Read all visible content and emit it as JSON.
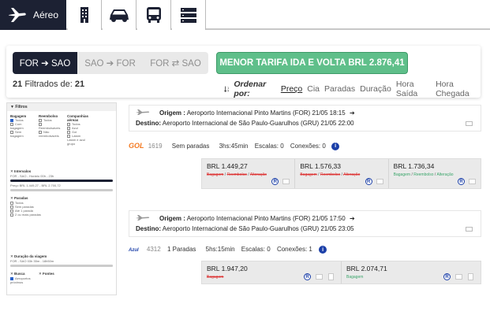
{
  "nav": {
    "active_label": "Aéreo",
    "tabs": [
      {
        "name": "hotel-icon"
      },
      {
        "name": "car-icon"
      },
      {
        "name": "bus-icon"
      },
      {
        "name": "menu-stack-icon"
      }
    ]
  },
  "search": {
    "route_options": [
      {
        "label": "FOR ➔ SAO",
        "active": true
      },
      {
        "label": "SAO ➔ FOR",
        "active": false
      },
      {
        "label": "FOR ⇄ SAO",
        "active": false
      }
    ],
    "lowest_fare_label": "MENOR TARIFA IDA E VOLTA BRL 2.876,41",
    "filtered_count": "21",
    "filtered_text": "Filtrados de:",
    "total": "21",
    "sort": {
      "label": "Ordenar por:",
      "options": [
        "Preço",
        "Cia",
        "Paradas",
        "Duração",
        "Hora Saída",
        "Hora Chegada"
      ]
    }
  },
  "filters": {
    "title": "Filtros",
    "bagagem": {
      "title": "Bagagem",
      "items": [
        "Todos",
        "Com bagagem",
        "Sem bagagem"
      ]
    },
    "reembolso": {
      "title": "Reembolso",
      "items": [
        "Todos",
        "Reembolsáveis",
        "Não reembolsáveis"
      ]
    },
    "companhias": {
      "title": "Companhias aéreas",
      "items": [
        "Todos",
        "Azul",
        "Gol",
        "Latam",
        "Latam e azul",
        "grupo"
      ]
    },
    "intervalos": {
      "title": "Intervalos",
      "horario": "FOR - SAO - Horário",
      "horario_range": "00h - 23h",
      "preco": "Preço",
      "preco_range": "BRL 1.449,27 - BRL 2.700,72"
    },
    "paradas": {
      "title": "Paradas",
      "items": [
        "Todos",
        "Sem paradas",
        "Até 1 parada",
        "2 ou mais paradas"
      ]
    },
    "duracao": {
      "title": "Duração da viagem",
      "text": "FOR - SAO",
      "range": "03h 35m - 18h50m"
    },
    "busca": {
      "title": "Busca",
      "item": "Aeroportos próximos"
    },
    "fontes": {
      "title": "Fontes"
    }
  },
  "results": [
    {
      "origem_label": "Origem :",
      "origem": "Aeroporto Internacional Pinto Martins (FOR)",
      "origem_time": "21/05 18:15",
      "destino_label": "Destino:",
      "destino": "Aeroporto Internacional de São Paulo-Guarulhos (GRU)",
      "destino_time": "21/05 22:00",
      "airline": "GOL",
      "flight": "1619",
      "stops": "Sem paradas",
      "duration": "3hs:45min",
      "escalas": "Escalas: 0",
      "conexoes": "Conexões: 0",
      "fares": [
        {
          "price": "BRL 1.449,27",
          "opts": [
            "Bagagem",
            "Reembolso",
            "Alteração"
          ],
          "included": [
            false,
            false,
            false
          ]
        },
        {
          "price": "BRL 1.576,33",
          "opts": [
            "Bagagem",
            "Reembolso",
            "Alteração"
          ],
          "included": [
            false,
            false,
            false
          ]
        },
        {
          "price": "BRL 1.736,34",
          "opts": [
            "Bagagem",
            "Reembolso",
            "Alteração"
          ],
          "included": [
            true,
            true,
            true
          ]
        }
      ]
    },
    {
      "origem_label": "Origem :",
      "origem": "Aeroporto Internacional Pinto Martins (FOR)",
      "origem_time": "21/05 17:50",
      "destino_label": "Destino:",
      "destino": "Aeroporto Internacional de São Paulo-Guarulhos (GRU)",
      "destino_time": "21/05 23:05",
      "airline": "Azul",
      "flight": "4312",
      "stops": "1 Paradas",
      "duration": "5hs:15min",
      "escalas": "Escalas: 0",
      "conexoes": "Conexões: 1",
      "fares": [
        {
          "price": "BRL 1.947,20",
          "opts": [
            "Bagagem"
          ],
          "included": [
            false
          ]
        },
        {
          "price": "BRL 2.074,71",
          "opts": [
            "Bagagem"
          ],
          "included": [
            true
          ]
        }
      ]
    }
  ],
  "colors": {
    "dark": "#1c2133",
    "green": "#5fbf8a",
    "blue": "#1b3fa8",
    "strike": "#dd3333"
  }
}
